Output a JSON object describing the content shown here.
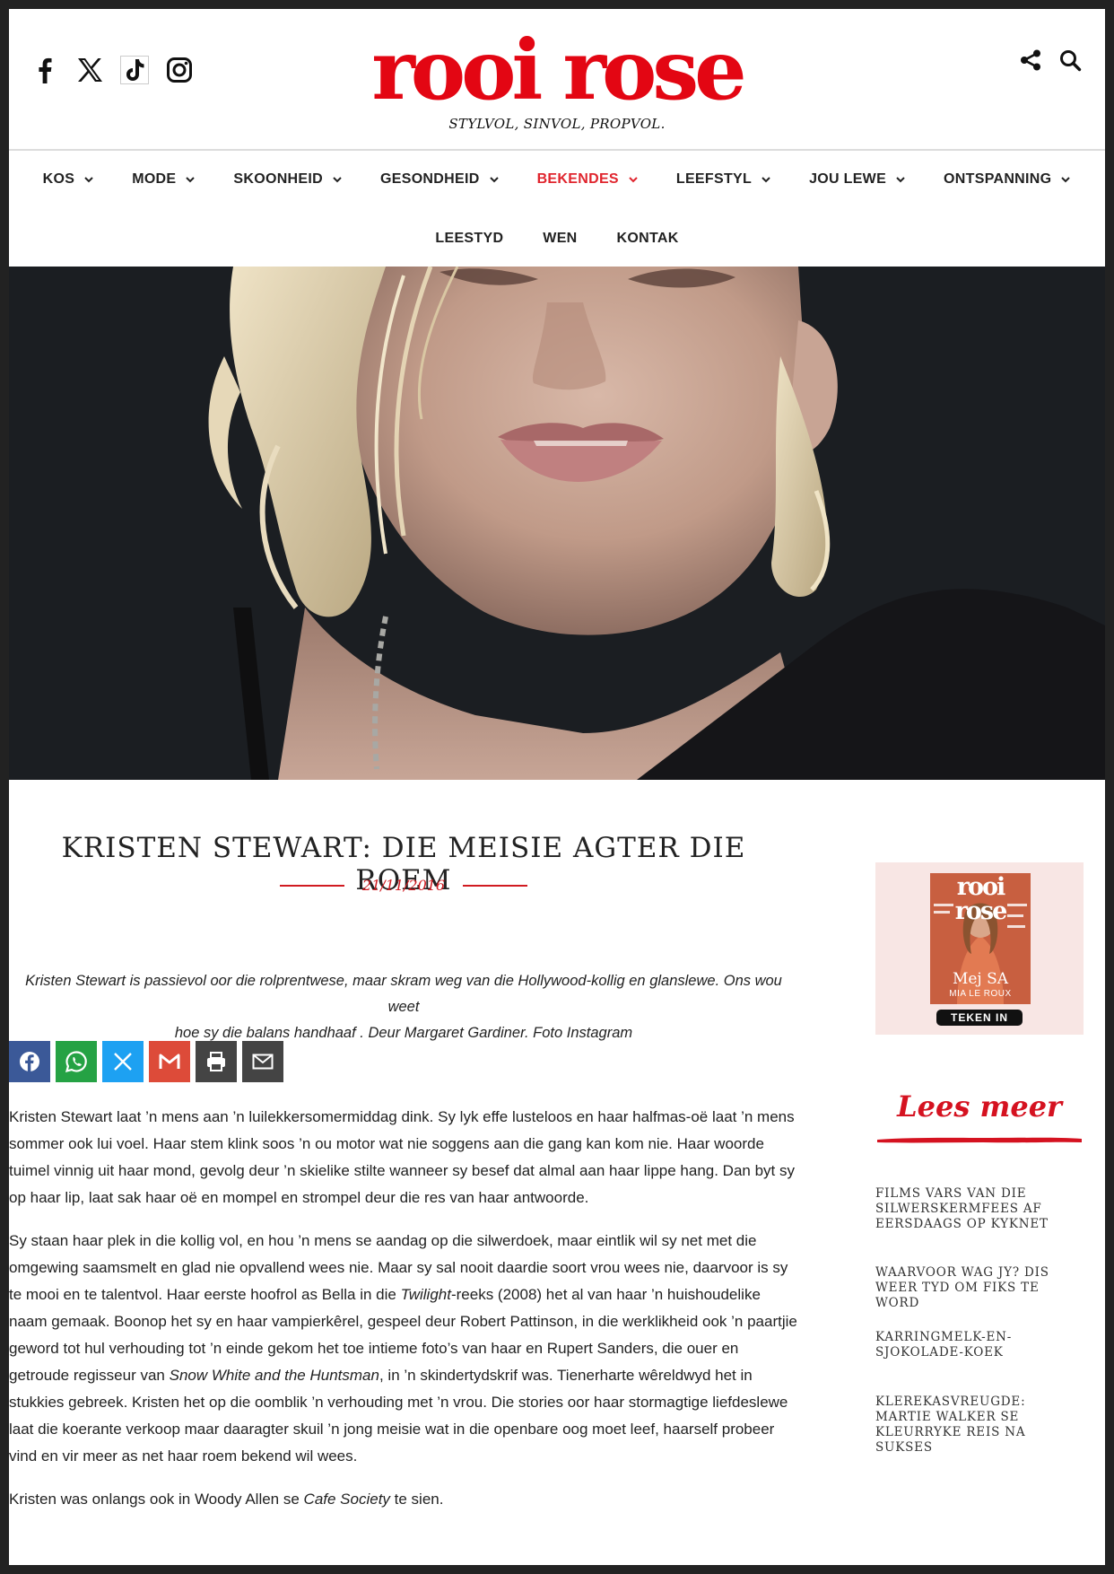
{
  "site": {
    "logo_text": "rooi rose",
    "tagline": "STYLVOL, SINVOL, PROPVOL.",
    "social_icons": [
      "facebook-icon",
      "x-icon",
      "tiktok-icon",
      "instagram-icon"
    ],
    "tool_icons": [
      "share-icon",
      "search-icon"
    ],
    "colors": {
      "brand_red": "#e30613",
      "active_nav": "#e0252e",
      "text": "#222222",
      "subscribe_bg": "#f8e6e4"
    }
  },
  "nav": {
    "row1": [
      "KOS",
      "MODE",
      "SKOONHEID",
      "GESONDHEID",
      "BEKENDES",
      "LEEFSTYL",
      "JOU LEWE",
      "ONTSPANNING"
    ],
    "row2": [
      "LEESTYD",
      "WEN",
      "KONTAK"
    ],
    "active": "BEKENDES"
  },
  "article": {
    "title": "KRISTEN STEWART: DIE MEISIE AGTER DIE ROEM",
    "date": "21/11/2016",
    "intro_line1": "Kristen Stewart is passievol oor die rolprentwese, maar skram weg van die Hollywood-kollig en glanslewe. Ons wou weet",
    "intro_line2": "hoe sy die balans handhaaf . Deur Margaret Gardiner. Foto Instagram",
    "share_buttons": [
      {
        "name": "facebook",
        "icon": "facebook-icon",
        "color": "#3b5998"
      },
      {
        "name": "whatsapp",
        "icon": "whatsapp-icon",
        "color": "#25a244"
      },
      {
        "name": "x",
        "icon": "x-icon",
        "color": "#1da1f2"
      },
      {
        "name": "gmail",
        "icon": "gmail-icon",
        "color": "#dd4b39"
      },
      {
        "name": "print",
        "icon": "print-icon",
        "color": "#444444"
      },
      {
        "name": "email",
        "icon": "email-icon",
        "color": "#444444"
      }
    ],
    "p1": "Kristen Stewart laat ’n mens aan ’n luilekkersomermiddag dink. Sy lyk effe lusteloos en haar halfmas-oë laat ’n mens sommer ook lui voel. Haar stem klink soos ’n ou motor wat nie soggens aan die gang kan kom nie. Haar woorde tuimel vinnig uit haar mond, gevolg deur ’n skielike stilte wanneer sy besef dat almal aan haar lippe hang. Dan byt sy op haar lip, laat sak haar oë en mompel en strompel deur die res van haar antwoorde.",
    "p2_a": "Sy staan haar plek in die kollig vol, en hou ’n mens se aandag op die silwerdoek, maar eintlik wil sy net met die omgewing saamsmelt en glad nie opvallend wees nie. Maar sy sal nooit daardie soort vrou wees nie, daarvoor is sy te mooi en te talentvol. Haar eerste hoofrol as Bella in die ",
    "p2_em1": "Twilight",
    "p2_b": "-reeks (2008) het al van haar ’n huishoudelike naam gemaak. Boonop het sy en haar vampierkêrel, gespeel deur Robert Pattinson, in die werklikheid ook ’n paartjie geword tot hul verhouding tot ’n einde gekom het toe intieme foto’s van haar en Rupert Sanders, die ouer en getroude regisseur van ",
    "p2_em2": "Snow White and the Huntsman",
    "p2_c": ", in ’n skindertydskrif was. Tienerharte wêreldwyd het in stukkies gebreek. Kristen het op die oomblik ’n verhouding met ’n vrou. Die stories oor haar stormagtige liefdeslewe laat die koerante verkoop maar daaragter skuil ’n jong meisie wat in die openbare oog moet leef, haarself probeer vind en vir meer as net haar roem bekend wil wees.",
    "p3_a": "Kristen was onlangs ook in Woody Allen se ",
    "p3_em": "Cafe Society",
    "p3_b": " te sien."
  },
  "sidebar": {
    "magazine_title": "rooi rose",
    "magazine_cover_name": "Mej SA",
    "magazine_cover_sub": "MIA LE ROUX",
    "subscribe_label": "TEKEN IN",
    "lees_meer": "Lees meer",
    "related": [
      "FILMS VARS VAN DIE SILWERSKERMFEES AF EERSDAAGS OP KYKNET",
      "WAARVOOR WAG JY? DIS WEER TYD OM FIKS TE WORD",
      "KARRINGMELK-EN-SJOKOLADE-KOEK",
      "KLEREKASVREUGDE: MARTIE WALKER SE KLEURRYKE REIS NA SUKSES"
    ]
  }
}
